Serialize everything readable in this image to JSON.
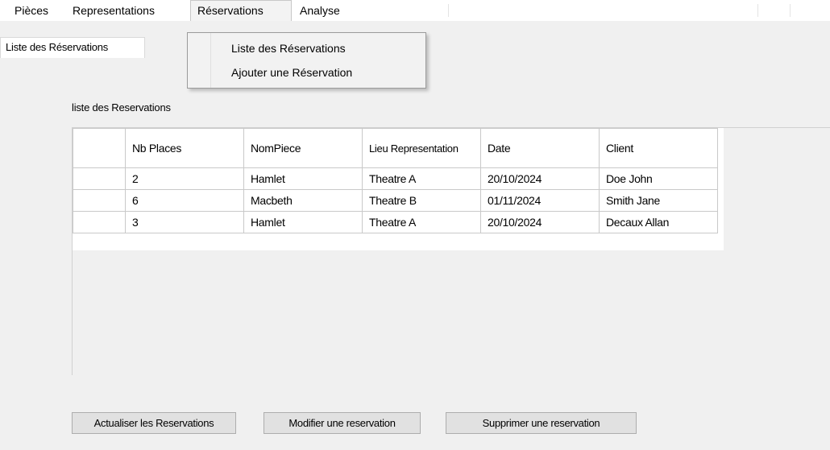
{
  "menu": {
    "items": [
      {
        "label": "Pièces"
      },
      {
        "label": "Representations"
      },
      {
        "label": "Réservations"
      },
      {
        "label": "Analyse"
      }
    ],
    "dropdown": [
      {
        "label": "Liste des Réservations"
      },
      {
        "label": "Ajouter une Réservation"
      }
    ]
  },
  "tab": {
    "label": "Liste des Réservations"
  },
  "section": {
    "title": "liste des Reservations"
  },
  "table": {
    "headers": [
      "Nb Places",
      "NomPiece",
      "Lieu Representation",
      "Date",
      "Client"
    ],
    "rows": [
      [
        "2",
        "Hamlet",
        "Theatre A",
        "20/10/2024",
        "Doe John"
      ],
      [
        "6",
        "Macbeth",
        "Theatre B",
        "01/11/2024",
        "Smith Jane"
      ],
      [
        "3",
        "Hamlet",
        "Theatre A",
        "20/10/2024",
        "Decaux Allan"
      ]
    ]
  },
  "buttons": {
    "refresh": "Actualiser les Reservations",
    "edit": "Modifier une reservation",
    "delete": "Supprimer une reservation"
  }
}
